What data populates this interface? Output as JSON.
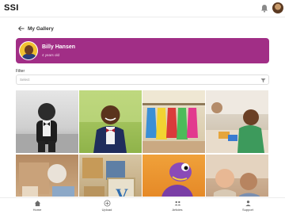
{
  "app": {
    "logo": "SSI"
  },
  "header": {
    "back_title": "My Gallery"
  },
  "profile": {
    "name": "Billy Hansen",
    "age": "4 years old"
  },
  "filter": {
    "label": "Filter",
    "placeholder": "Select"
  },
  "gallery": {
    "photos": [
      {
        "alt": "black-and-white photo of a boy in a bow tie"
      },
      {
        "alt": "smiling boy in a navy blazer and bow tie"
      },
      {
        "alt": "colorful children's aprons hanging on hooks"
      },
      {
        "alt": "boy building with blocks at a table"
      },
      {
        "alt": "wooden toys and a plush animal in a box"
      },
      {
        "alt": "wooden alphabet blocks"
      },
      {
        "alt": "purple toy dinosaur"
      },
      {
        "alt": "two toddlers sitting together"
      }
    ]
  },
  "nav": {
    "home": "Home",
    "upload": "Upload",
    "articles": "Articles",
    "support": "Support"
  },
  "colors": {
    "accent": "#a12e86"
  }
}
